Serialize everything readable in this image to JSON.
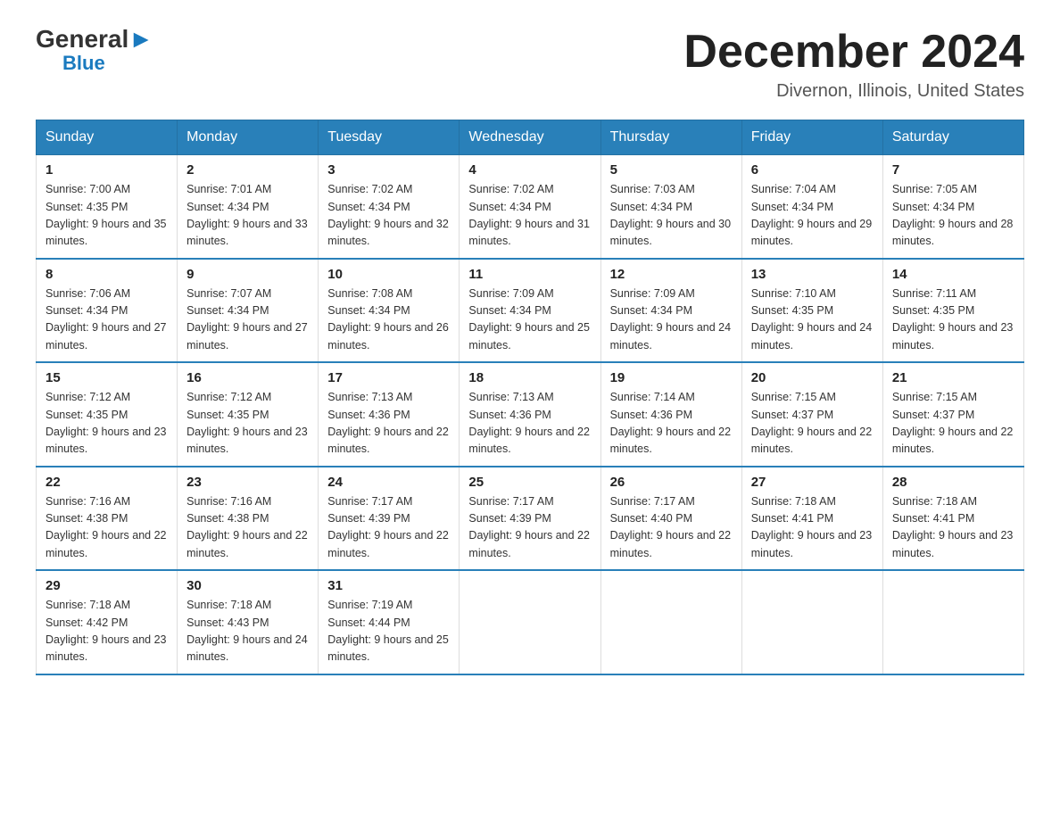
{
  "header": {
    "logo_general": "General",
    "logo_blue": "Blue",
    "month_title": "December 2024",
    "location": "Divernon, Illinois, United States"
  },
  "days_of_week": [
    "Sunday",
    "Monday",
    "Tuesday",
    "Wednesday",
    "Thursday",
    "Friday",
    "Saturday"
  ],
  "weeks": [
    [
      {
        "day": "1",
        "sunrise": "7:00 AM",
        "sunset": "4:35 PM",
        "daylight": "9 hours and 35 minutes."
      },
      {
        "day": "2",
        "sunrise": "7:01 AM",
        "sunset": "4:34 PM",
        "daylight": "9 hours and 33 minutes."
      },
      {
        "day": "3",
        "sunrise": "7:02 AM",
        "sunset": "4:34 PM",
        "daylight": "9 hours and 32 minutes."
      },
      {
        "day": "4",
        "sunrise": "7:02 AM",
        "sunset": "4:34 PM",
        "daylight": "9 hours and 31 minutes."
      },
      {
        "day": "5",
        "sunrise": "7:03 AM",
        "sunset": "4:34 PM",
        "daylight": "9 hours and 30 minutes."
      },
      {
        "day": "6",
        "sunrise": "7:04 AM",
        "sunset": "4:34 PM",
        "daylight": "9 hours and 29 minutes."
      },
      {
        "day": "7",
        "sunrise": "7:05 AM",
        "sunset": "4:34 PM",
        "daylight": "9 hours and 28 minutes."
      }
    ],
    [
      {
        "day": "8",
        "sunrise": "7:06 AM",
        "sunset": "4:34 PM",
        "daylight": "9 hours and 27 minutes."
      },
      {
        "day": "9",
        "sunrise": "7:07 AM",
        "sunset": "4:34 PM",
        "daylight": "9 hours and 27 minutes."
      },
      {
        "day": "10",
        "sunrise": "7:08 AM",
        "sunset": "4:34 PM",
        "daylight": "9 hours and 26 minutes."
      },
      {
        "day": "11",
        "sunrise": "7:09 AM",
        "sunset": "4:34 PM",
        "daylight": "9 hours and 25 minutes."
      },
      {
        "day": "12",
        "sunrise": "7:09 AM",
        "sunset": "4:34 PM",
        "daylight": "9 hours and 24 minutes."
      },
      {
        "day": "13",
        "sunrise": "7:10 AM",
        "sunset": "4:35 PM",
        "daylight": "9 hours and 24 minutes."
      },
      {
        "day": "14",
        "sunrise": "7:11 AM",
        "sunset": "4:35 PM",
        "daylight": "9 hours and 23 minutes."
      }
    ],
    [
      {
        "day": "15",
        "sunrise": "7:12 AM",
        "sunset": "4:35 PM",
        "daylight": "9 hours and 23 minutes."
      },
      {
        "day": "16",
        "sunrise": "7:12 AM",
        "sunset": "4:35 PM",
        "daylight": "9 hours and 23 minutes."
      },
      {
        "day": "17",
        "sunrise": "7:13 AM",
        "sunset": "4:36 PM",
        "daylight": "9 hours and 22 minutes."
      },
      {
        "day": "18",
        "sunrise": "7:13 AM",
        "sunset": "4:36 PM",
        "daylight": "9 hours and 22 minutes."
      },
      {
        "day": "19",
        "sunrise": "7:14 AM",
        "sunset": "4:36 PM",
        "daylight": "9 hours and 22 minutes."
      },
      {
        "day": "20",
        "sunrise": "7:15 AM",
        "sunset": "4:37 PM",
        "daylight": "9 hours and 22 minutes."
      },
      {
        "day": "21",
        "sunrise": "7:15 AM",
        "sunset": "4:37 PM",
        "daylight": "9 hours and 22 minutes."
      }
    ],
    [
      {
        "day": "22",
        "sunrise": "7:16 AM",
        "sunset": "4:38 PM",
        "daylight": "9 hours and 22 minutes."
      },
      {
        "day": "23",
        "sunrise": "7:16 AM",
        "sunset": "4:38 PM",
        "daylight": "9 hours and 22 minutes."
      },
      {
        "day": "24",
        "sunrise": "7:17 AM",
        "sunset": "4:39 PM",
        "daylight": "9 hours and 22 minutes."
      },
      {
        "day": "25",
        "sunrise": "7:17 AM",
        "sunset": "4:39 PM",
        "daylight": "9 hours and 22 minutes."
      },
      {
        "day": "26",
        "sunrise": "7:17 AM",
        "sunset": "4:40 PM",
        "daylight": "9 hours and 22 minutes."
      },
      {
        "day": "27",
        "sunrise": "7:18 AM",
        "sunset": "4:41 PM",
        "daylight": "9 hours and 23 minutes."
      },
      {
        "day": "28",
        "sunrise": "7:18 AM",
        "sunset": "4:41 PM",
        "daylight": "9 hours and 23 minutes."
      }
    ],
    [
      {
        "day": "29",
        "sunrise": "7:18 AM",
        "sunset": "4:42 PM",
        "daylight": "9 hours and 23 minutes."
      },
      {
        "day": "30",
        "sunrise": "7:18 AM",
        "sunset": "4:43 PM",
        "daylight": "9 hours and 24 minutes."
      },
      {
        "day": "31",
        "sunrise": "7:19 AM",
        "sunset": "4:44 PM",
        "daylight": "9 hours and 25 minutes."
      },
      null,
      null,
      null,
      null
    ]
  ]
}
